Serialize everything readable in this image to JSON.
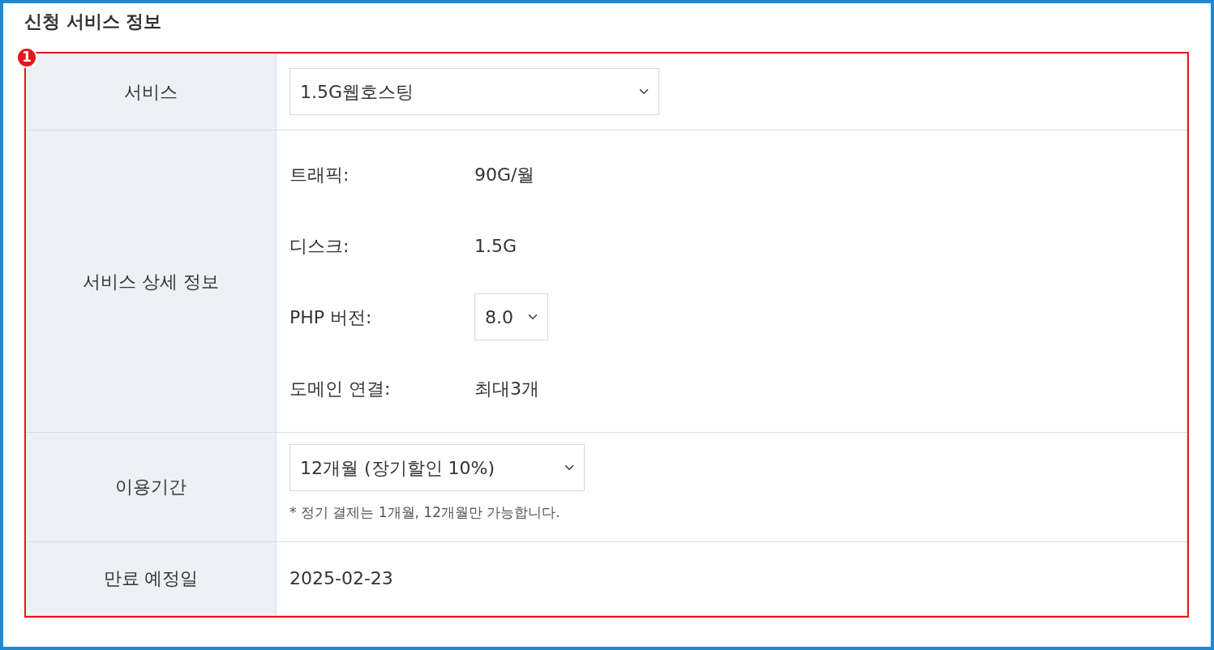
{
  "section_title": "신청 서비스 정보",
  "annotation": {
    "number": "1"
  },
  "rows": [
    {
      "kind": "select",
      "label": "서비스",
      "value": "1.5G웹호스팅"
    },
    {
      "kind": "specs",
      "label": "서비스 상세 정보",
      "specs": [
        {
          "kind": "text",
          "name": "트래픽:",
          "value": "90G/월"
        },
        {
          "kind": "text",
          "name": "디스크:",
          "value": "1.5G"
        },
        {
          "kind": "select",
          "name": "PHP 버전:",
          "value": "8.0"
        },
        {
          "kind": "text",
          "name": "도메인 연결:",
          "value": "최대3개"
        }
      ]
    },
    {
      "kind": "select",
      "label": "이용기간",
      "value": "12개월 (장기할인 10%)",
      "note": "* 정기 결제는 1개월, 12개월만 가능합니다."
    },
    {
      "kind": "text",
      "label": "만료 예정일",
      "value": "2025-02-23"
    }
  ]
}
